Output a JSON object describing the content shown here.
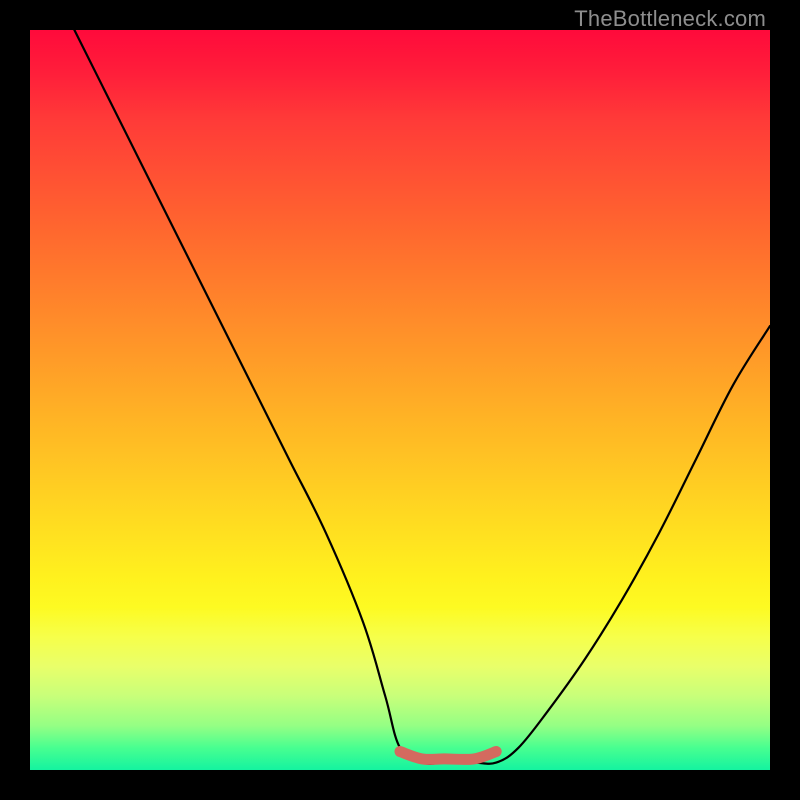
{
  "watermark": "TheBottleneck.com",
  "chart_data": {
    "type": "line",
    "title": "",
    "xlabel": "",
    "ylabel": "",
    "xlim": [
      0,
      100
    ],
    "ylim": [
      0,
      100
    ],
    "grid": false,
    "series": [
      {
        "name": "black-curve",
        "color": "#000000",
        "x": [
          6,
          10,
          15,
          20,
          25,
          30,
          35,
          40,
          45,
          48,
          50,
          53,
          56,
          60,
          63,
          66,
          70,
          75,
          80,
          85,
          90,
          95,
          100
        ],
        "values": [
          100,
          92,
          82,
          72,
          62,
          52,
          42,
          32,
          20,
          10,
          3,
          1,
          1,
          1,
          1,
          3,
          8,
          15,
          23,
          32,
          42,
          52,
          60
        ]
      },
      {
        "name": "red-flat-segment",
        "color": "#d46a5f",
        "x": [
          50,
          53,
          56,
          60,
          63
        ],
        "values": [
          2.5,
          1.5,
          1.5,
          1.5,
          2.5
        ]
      }
    ]
  }
}
